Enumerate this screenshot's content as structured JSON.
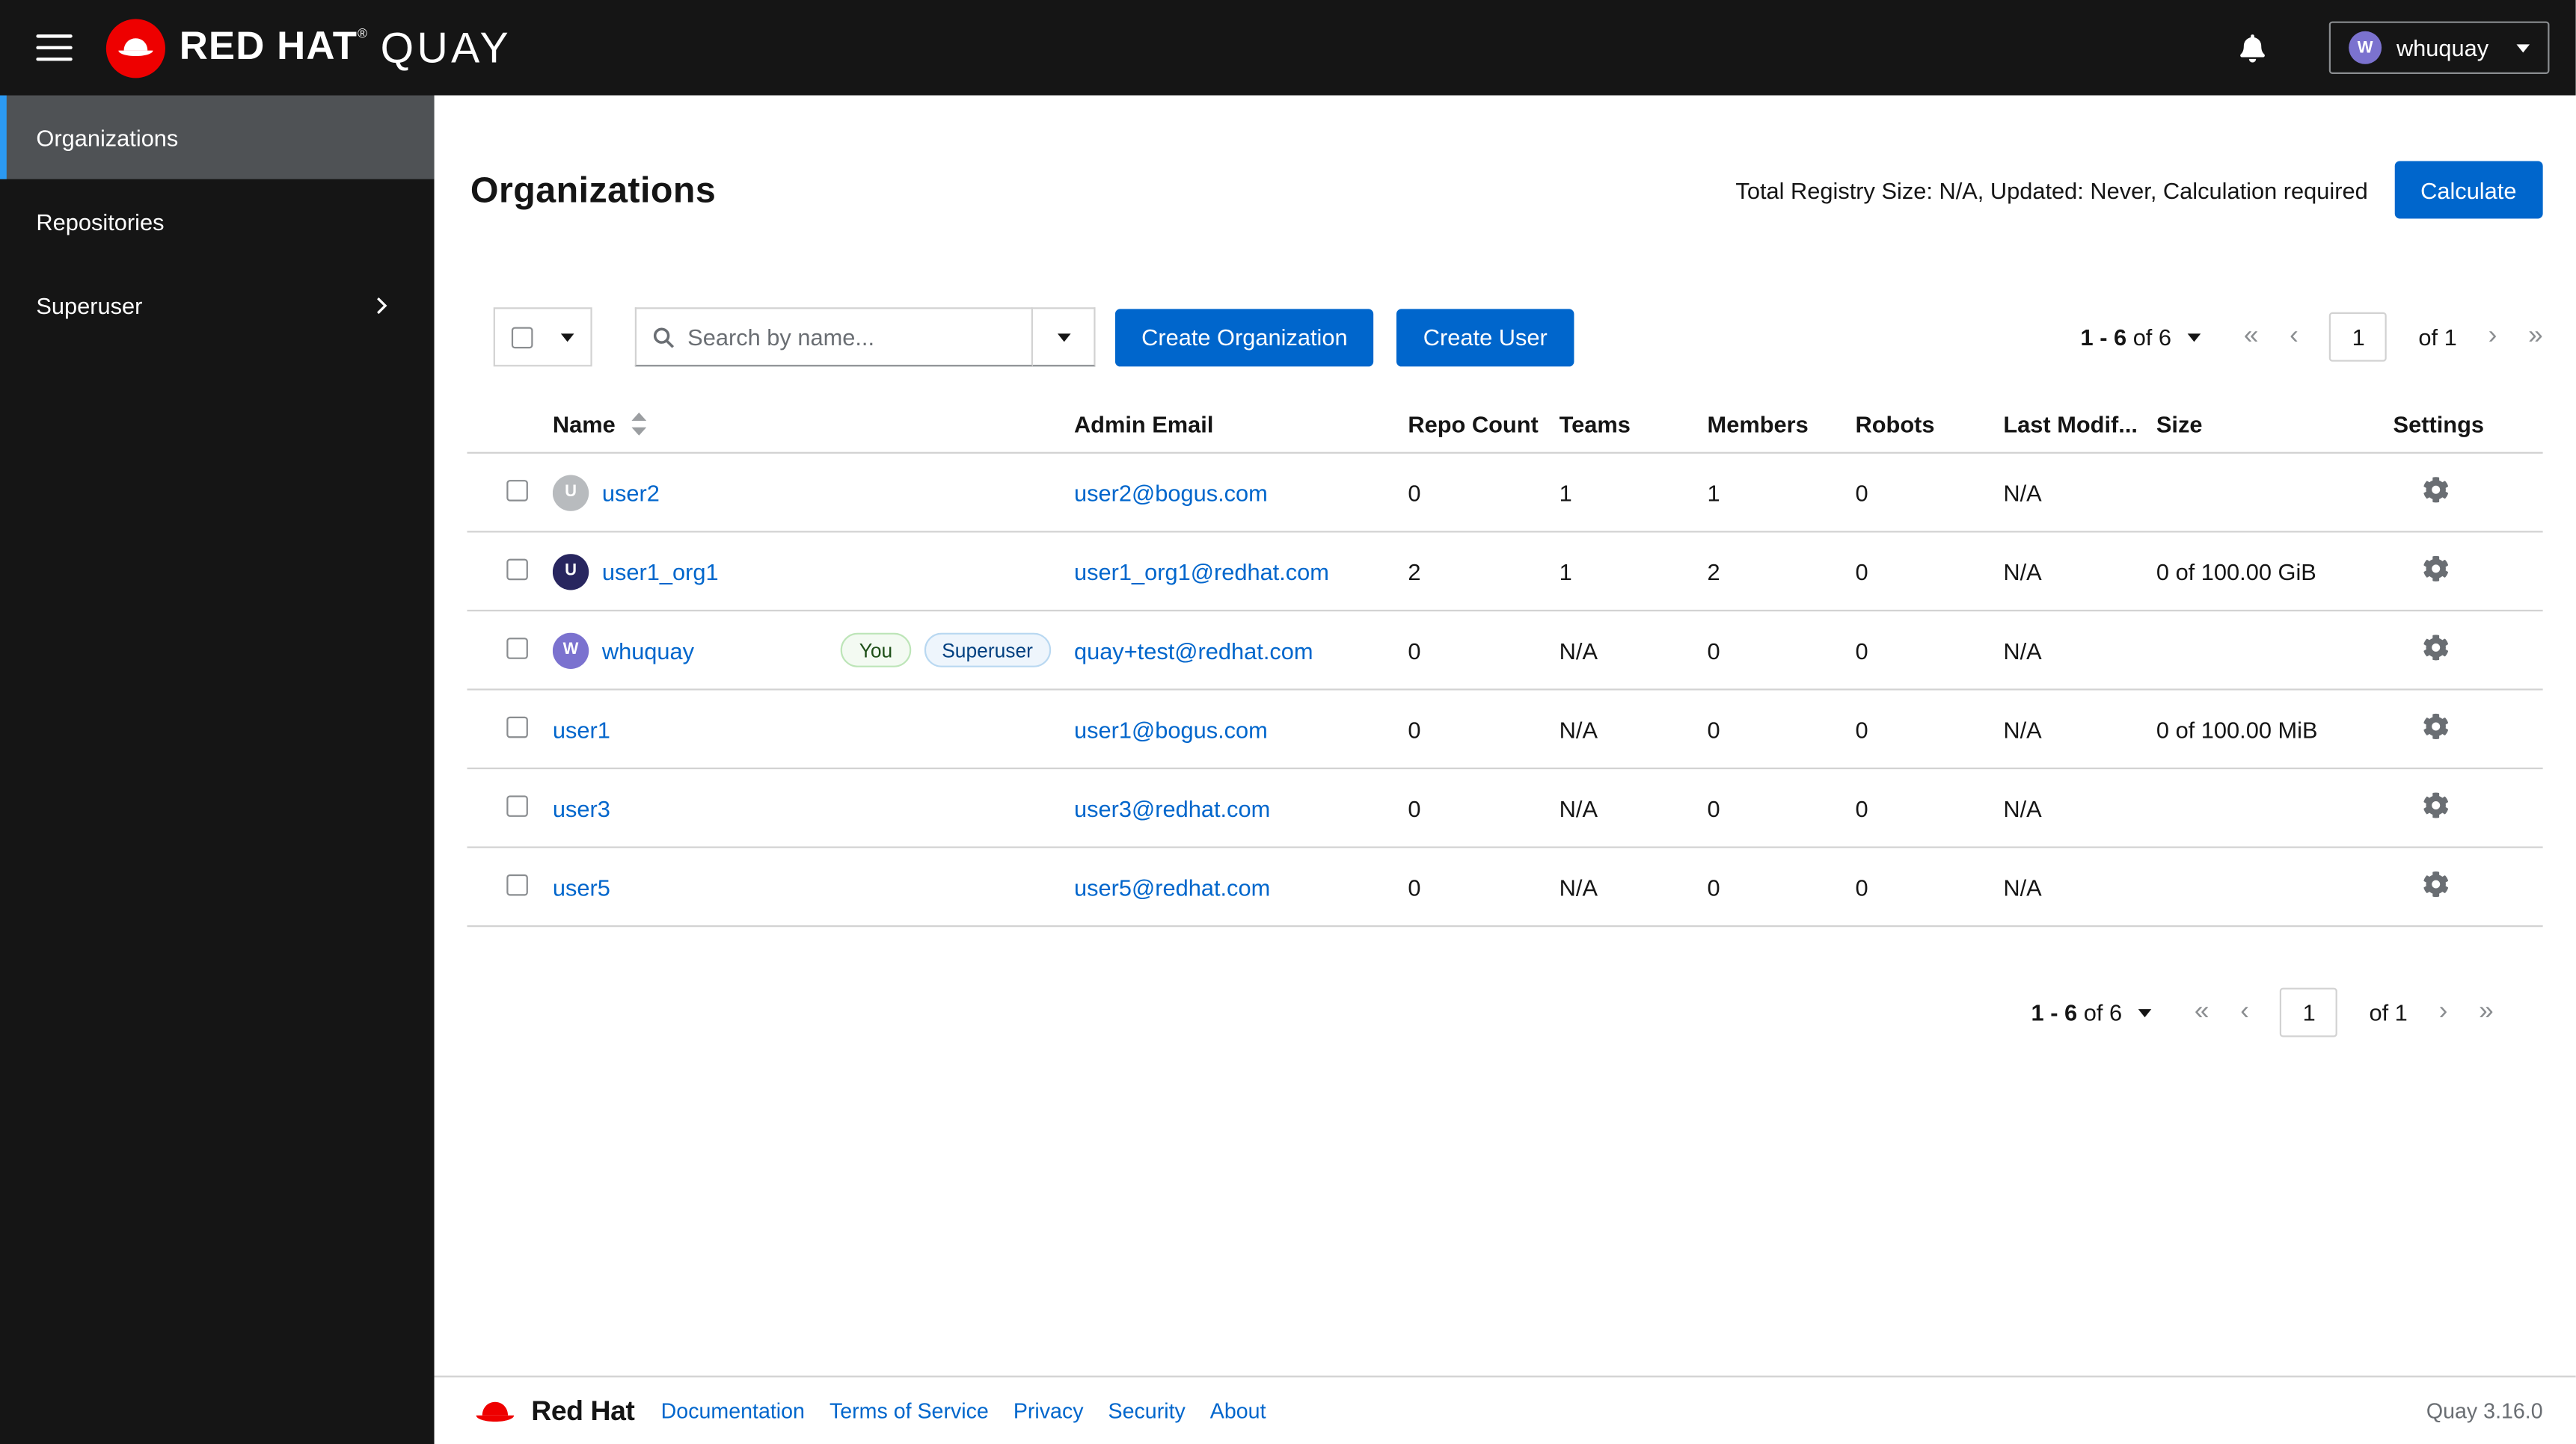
{
  "colors": {
    "primary": "#0066cc",
    "link": "#0066cc",
    "masthead_bg": "#151515",
    "selected_nav_bg": "#4f5255",
    "nav_accent": "#2b9af3",
    "border": "#d2d2d2",
    "muted_text": "#6a6e73",
    "brand_red": "#ee0000"
  },
  "icons": {
    "hamburger-icon": "three horizontal bars",
    "brand-logo-icon": "red hat fedora in red circle",
    "bell-icon": "notification bell",
    "caret-down-icon": "▾",
    "search-icon": "magnifier",
    "sort-icon": "⇅",
    "chevron-right-icon": "›",
    "gear-icon": "settings cog",
    "pagination_arrows": [
      "«",
      "‹",
      "›",
      "»"
    ]
  },
  "masthead": {
    "brand_red_hat": "RED HAT",
    "brand_reg": "®",
    "brand_quay": "QUAY",
    "user": {
      "name": "whuquay",
      "initial": "W",
      "avatar_color": "#7b72cf"
    }
  },
  "sidebar": {
    "items": [
      {
        "label": "Organizations",
        "selected": true
      },
      {
        "label": "Repositories",
        "selected": false
      },
      {
        "label": "Superuser",
        "selected": false,
        "expandable": true
      }
    ]
  },
  "page": {
    "title": "Organizations",
    "registry_summary": "Total Registry Size: N/A, Updated: Never, Calculation required",
    "calculate_label": "Calculate"
  },
  "toolbar": {
    "search_placeholder": "Search by name...",
    "create_org_label": "Create Organization",
    "create_user_label": "Create User"
  },
  "pagination": {
    "range": "1 - 6",
    "total": "of 6",
    "page": "1",
    "of_pages": "of 1"
  },
  "table": {
    "columns": {
      "name": "Name",
      "admin_email": "Admin Email",
      "repo_count": "Repo Count",
      "teams": "Teams",
      "members": "Members",
      "robots": "Robots",
      "last_modified": "Last Modif...",
      "size": "Size",
      "settings": "Settings"
    },
    "rows": [
      {
        "name": "user2",
        "avatar": {
          "initial": "U",
          "color": "#b8bbbe"
        },
        "badges": [],
        "email": "user2@bogus.com",
        "repo_count": "0",
        "teams": "1",
        "members": "1",
        "robots": "0",
        "last_modified": "N/A",
        "size": ""
      },
      {
        "name": "user1_org1",
        "avatar": {
          "initial": "U",
          "color": "#28265f"
        },
        "badges": [],
        "email": "user1_org1@redhat.com",
        "repo_count": "2",
        "teams": "1",
        "members": "2",
        "robots": "0",
        "last_modified": "N/A",
        "size": "0 of 100.00 GiB"
      },
      {
        "name": "whuquay",
        "avatar": {
          "initial": "W",
          "color": "#7b72cf"
        },
        "badges": [
          {
            "label": "You",
            "type": "green"
          },
          {
            "label": "Superuser",
            "type": "blue"
          }
        ],
        "email": "quay+test@redhat.com",
        "repo_count": "0",
        "teams": "N/A",
        "members": "0",
        "robots": "0",
        "last_modified": "N/A",
        "size": ""
      },
      {
        "name": "user1",
        "badges": [],
        "email": "user1@bogus.com",
        "repo_count": "0",
        "teams": "N/A",
        "members": "0",
        "robots": "0",
        "last_modified": "N/A",
        "size": "0 of 100.00 MiB"
      },
      {
        "name": "user3",
        "badges": [],
        "email": "user3@redhat.com",
        "repo_count": "0",
        "teams": "N/A",
        "members": "0",
        "robots": "0",
        "last_modified": "N/A",
        "size": ""
      },
      {
        "name": "user5",
        "badges": [],
        "email": "user5@redhat.com",
        "repo_count": "0",
        "teams": "N/A",
        "members": "0",
        "robots": "0",
        "last_modified": "N/A",
        "size": ""
      }
    ]
  },
  "footer": {
    "brand": "Red Hat",
    "links": [
      "Documentation",
      "Terms of Service",
      "Privacy",
      "Security",
      "About"
    ],
    "version": "Quay 3.16.0"
  }
}
